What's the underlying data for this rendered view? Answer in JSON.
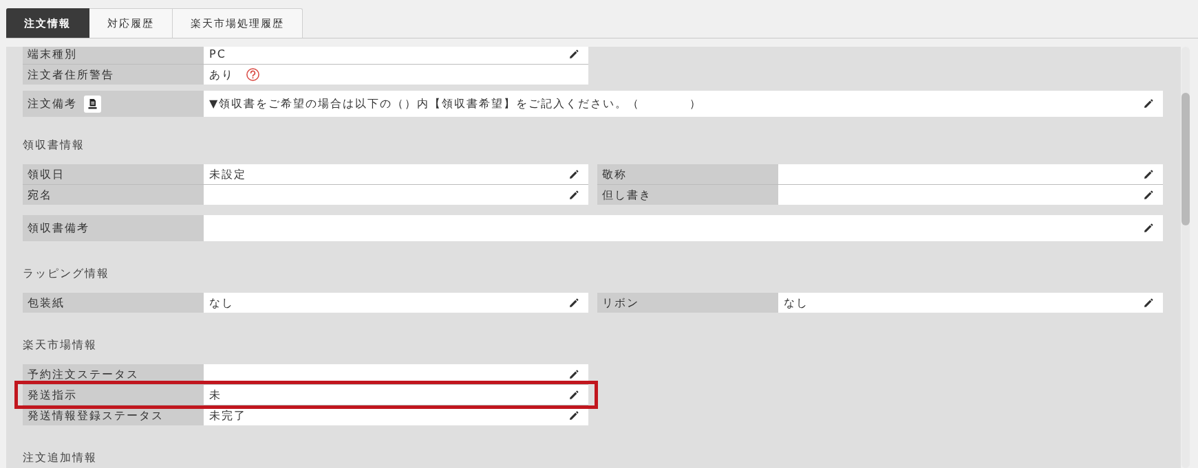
{
  "tabs": [
    {
      "label": "注文情報",
      "selected": true
    },
    {
      "label": "対応履歴",
      "selected": false
    },
    {
      "label": "楽天市場処理履歴",
      "selected": false
    }
  ],
  "sections": [
    {
      "blocks": [
        {
          "kind": "half",
          "fields": [
            {
              "label": "端末種別",
              "value": "PC",
              "editable": true
            },
            {
              "label": "注文者住所警告",
              "value": "あり",
              "editable": false,
              "help": true
            }
          ]
        },
        {
          "kind": "full",
          "fields": [
            {
              "label": "注文備考",
              "note_button": true,
              "value": "▼領収書をご希望の場合は以下の（）内【領収書希望】をご記入ください。（　　　　）",
              "editable": true
            }
          ]
        }
      ]
    },
    {
      "title": "領収書情報",
      "blocks": [
        {
          "kind": "grid",
          "fields": [
            {
              "label": "領収日",
              "value": "未設定",
              "editable": true
            },
            {
              "label": "敬称",
              "editable": true
            },
            {
              "label": "宛名",
              "editable": true
            },
            {
              "label": "但し書き",
              "editable": true
            }
          ]
        },
        {
          "kind": "full",
          "fields": [
            {
              "label": "領収書備考",
              "editable": true
            }
          ]
        }
      ]
    },
    {
      "title": "ラッピング情報",
      "blocks": [
        {
          "kind": "grid",
          "fields": [
            {
              "label": "包装紙",
              "value": "なし",
              "editable": true
            },
            {
              "label": "リボン",
              "value": "なし",
              "editable": true
            }
          ]
        }
      ]
    },
    {
      "title": "楽天市場情報",
      "blocks": [
        {
          "kind": "half",
          "fields": [
            {
              "label": "予約注文ステータス",
              "editable": true,
              "highlighted": false
            },
            {
              "label": "発送指示",
              "value": "未",
              "editable": true,
              "highlighted": true
            },
            {
              "label": "発送情報登録ステータス",
              "value": "未完了",
              "editable": true,
              "highlighted": false
            }
          ]
        }
      ]
    },
    {
      "title": "注文追加情報"
    }
  ]
}
